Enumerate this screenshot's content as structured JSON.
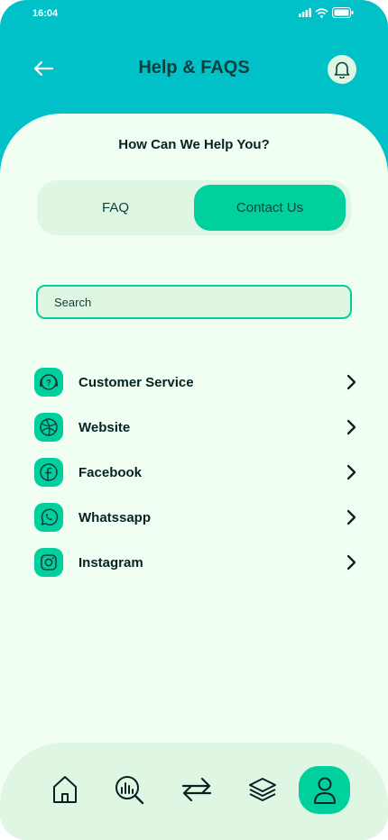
{
  "status_bar": {
    "time": "16:04"
  },
  "header": {
    "title": "Help & FAQS"
  },
  "subtitle": "How Can We Help You?",
  "tabs": [
    {
      "label": "FAQ",
      "active": false
    },
    {
      "label": "Contact Us",
      "active": true
    }
  ],
  "search": {
    "placeholder": "Search"
  },
  "contacts": [
    {
      "label": "Customer Service",
      "icon": "headset-icon"
    },
    {
      "label": "Website",
      "icon": "globe-icon"
    },
    {
      "label": "Facebook",
      "icon": "facebook-icon"
    },
    {
      "label": "Whatssapp",
      "icon": "whatsapp-icon"
    },
    {
      "label": "Instagram",
      "icon": "instagram-icon"
    }
  ],
  "bottom_nav": [
    {
      "icon": "home-icon",
      "active": false
    },
    {
      "icon": "analysis-icon",
      "active": false
    },
    {
      "icon": "transactions-icon",
      "active": false
    },
    {
      "icon": "categories-icon",
      "active": false
    },
    {
      "icon": "profile-icon",
      "active": true
    }
  ],
  "colors": {
    "header_bg": "#00C0C8",
    "accent": "#00D09E",
    "sheet_bg": "#F1FFF3",
    "light_green": "#DFF7E2",
    "text_dark": "#0E3E3E"
  }
}
